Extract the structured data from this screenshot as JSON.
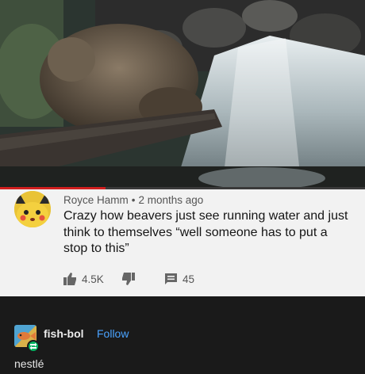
{
  "video": {
    "progress_fraction": 0.29,
    "progress_color": "#d11f1f"
  },
  "comment": {
    "author": "Royce Hamm",
    "separator": "•",
    "timestamp": "2 months ago",
    "text": "Crazy how beavers just see running water and just think to themselves “well someone has to put a stop to this”",
    "avatar_icon": "pikachu-avatar-icon",
    "likes": "4.5K",
    "replies": "45",
    "like_icon": "thumbs-up-icon",
    "dislike_icon": "thumbs-down-icon",
    "reply_icon": "reply-bubble-icon"
  },
  "post": {
    "blog_name": "fish-bol",
    "follow_label": "Follow",
    "caption": "nestlé",
    "accent_color": "#4aa3ff",
    "reblog_badge_color": "#00b35f"
  }
}
